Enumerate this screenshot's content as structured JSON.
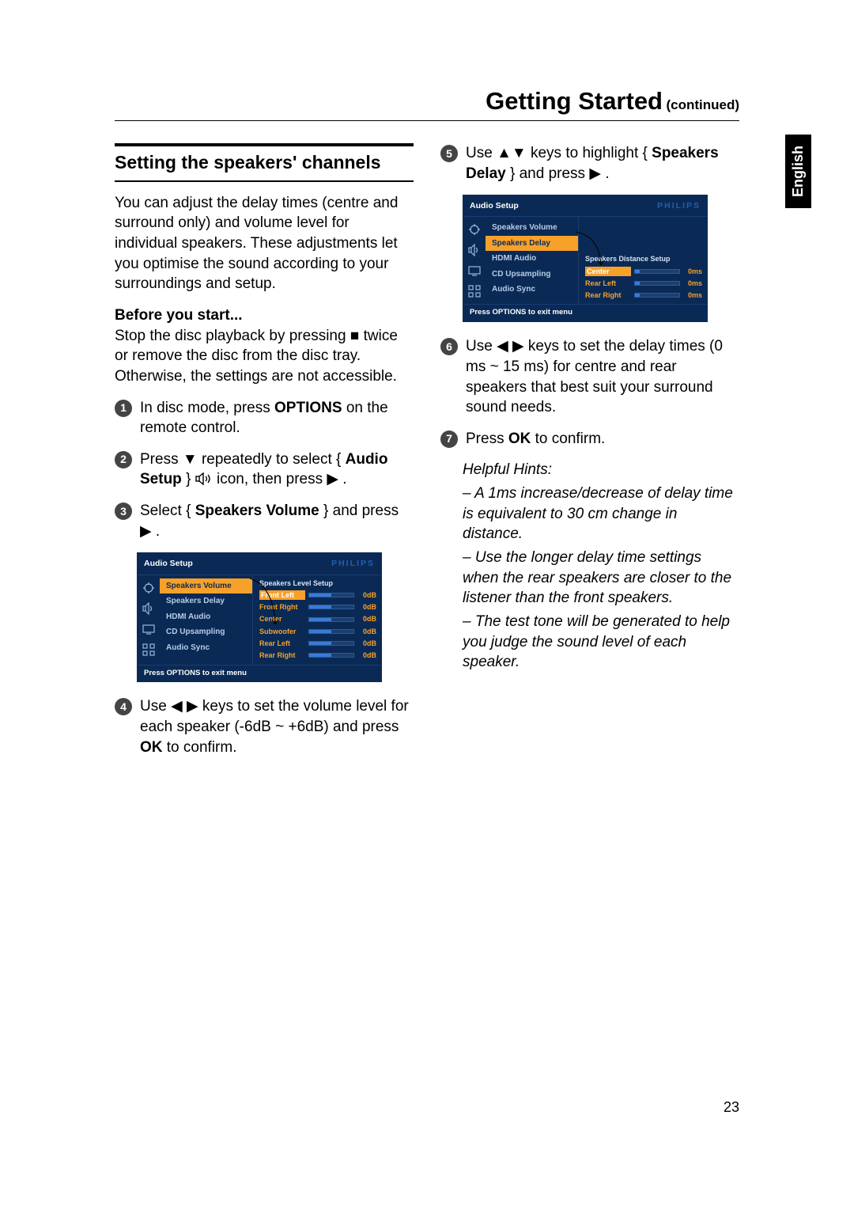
{
  "header": {
    "title": "Getting Started",
    "continued": "(continued)"
  },
  "sideTab": "English",
  "pageNumber": 23,
  "left": {
    "sectionTitle": "Setting the speakers' channels",
    "intro": "You can adjust the delay times (centre and surround only) and volume level for individual speakers. These adjustments let you optimise the sound according to your surroundings and setup.",
    "beforeHead": "Before you start...",
    "before_a": "Stop the disc playback by pressing ",
    "before_b": " twice or remove the disc from the disc tray. Otherwise, the settings are not accessible.",
    "s1_a": "In disc mode, press ",
    "s1_b": "OPTIONS",
    "s1_c": " on the remote control.",
    "s2_a": "Press ",
    "s2_b": " repeatedly to select { ",
    "s2_c": "Audio Setup",
    "s2_d": " } ",
    "s2_e": " icon, then press ",
    "s2_f": ".",
    "s3_a": "Select { ",
    "s3_b": "Speakers Volume",
    "s3_c": " } and press ",
    "s3_d": ".",
    "s4_a": "Use ",
    "s4_b": " keys to set the volume level for each speaker (-6dB ~ +6dB) and press ",
    "s4_c": "OK",
    "s4_d": " to confirm."
  },
  "right": {
    "s5_a": "Use ",
    "s5_b": " keys to highlight { ",
    "s5_c": "Speakers Delay",
    "s5_d": " } and press ",
    "s5_e": ".",
    "s6_a": "Use ",
    "s6_b": " keys to set the delay times (0 ms ~ 15 ms) for centre and rear speakers that best suit your surround sound needs.",
    "s7_a": "Press ",
    "s7_b": "OK",
    "s7_c": " to confirm.",
    "hintsHead": "Helpful Hints:",
    "h1": "– A 1ms increase/decrease of delay time is equivalent to 30 cm change in distance.",
    "h2": "– Use the longer delay time settings when the rear speakers are closer to the listener than the front speakers.",
    "h3": "– The test tone will be generated to help you judge the sound level of each speaker."
  },
  "osd": {
    "title": "Audio Setup",
    "brand": "PHILIPS",
    "footer": "Press OPTIONS to exit menu",
    "menu": [
      "Speakers Volume",
      "Speakers Delay",
      "HDMI Audio",
      "CD Upsampling",
      "Audio Sync"
    ],
    "panel1": {
      "title": "Speakers Level Setup",
      "rows": [
        {
          "label": "Front Left",
          "value": "0dB"
        },
        {
          "label": "Front Right",
          "value": "0dB"
        },
        {
          "label": "Center",
          "value": "0dB"
        },
        {
          "label": "Subwoofer",
          "value": "0dB"
        },
        {
          "label": "Rear Left",
          "value": "0dB"
        },
        {
          "label": "Rear Right",
          "value": "0dB"
        }
      ],
      "selectedMenuIndex": 0
    },
    "panel2": {
      "title": "Speakers Distance Setup",
      "rows": [
        {
          "label": "Center",
          "value": "0ms"
        },
        {
          "label": "Rear Left",
          "value": "0ms"
        },
        {
          "label": "Rear Right",
          "value": "0ms"
        }
      ],
      "selectedMenuIndex": 1
    }
  },
  "glyphs": {
    "stop": "■",
    "up": "▲",
    "down": "▼",
    "left": "◀",
    "right": "▶"
  }
}
